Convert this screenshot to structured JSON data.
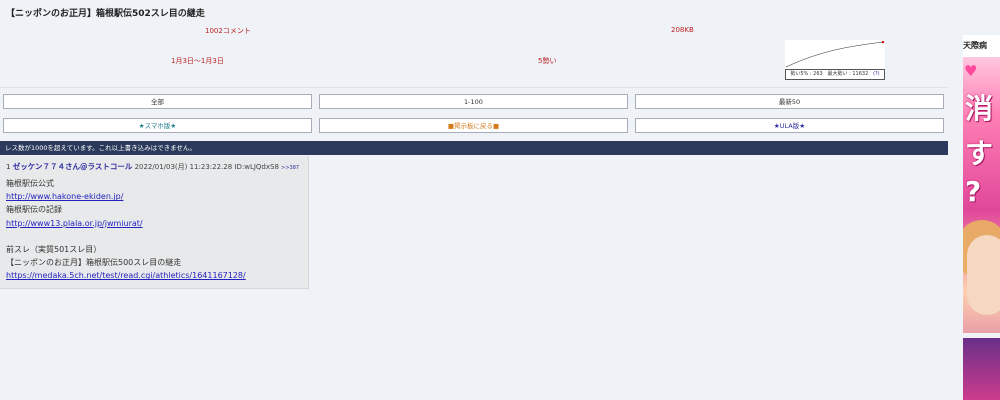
{
  "thread": {
    "title": "【ニッポンのお正月】箱根駅伝502スレ目の継走"
  },
  "meta": {
    "comments": "1002コメント",
    "size": "208KB",
    "date_range": "1月3日～1月3日",
    "speed": "5勢い"
  },
  "graph": {
    "caption_left": "勢い5% : 263",
    "caption_right": "最大勢い : 11632",
    "help": "(?)",
    "line_color": "#333333",
    "end_dot_color": "#d02020"
  },
  "nav": {
    "all": "全部",
    "range": "1-100",
    "latest": "最新50",
    "smartphone": "★スマホ版★",
    "back_to_board": "■掲示板に戻る■",
    "ula": "★ULA版★"
  },
  "notice": "レス数が1000を超えています。これ以上書き込みはできません。",
  "post": {
    "number": "1",
    "name": "ゼッケン７７４さん@ラストコール",
    "date": "2022/01/03(月) 11:23:22.28",
    "id": "ID:wLJQdxS8",
    "reply": ">>387",
    "lines": [
      {
        "text": "箱根駅伝公式",
        "link": false
      },
      {
        "text": "http://www.hakone-ekiden.jp/",
        "link": true
      },
      {
        "text": "箱根駅伝の記録",
        "link": false
      },
      {
        "text": "http://www13.plala.or.jp/jwmiurat/",
        "link": true
      },
      {
        "text": "",
        "link": false
      },
      {
        "text": "前スレ（実質501スレ目）",
        "link": false
      },
      {
        "text": "【ニッポンのお正月】箱根駅伝500スレ目の継走",
        "link": false
      },
      {
        "text": "https://medaka.5ch.net/test/read.cgi/athletics/1641167128/",
        "link": true
      }
    ]
  },
  "ad": {
    "title": "天際病",
    "big1": "消",
    "big2": "す",
    "big3": "?",
    "heart": "♥"
  }
}
